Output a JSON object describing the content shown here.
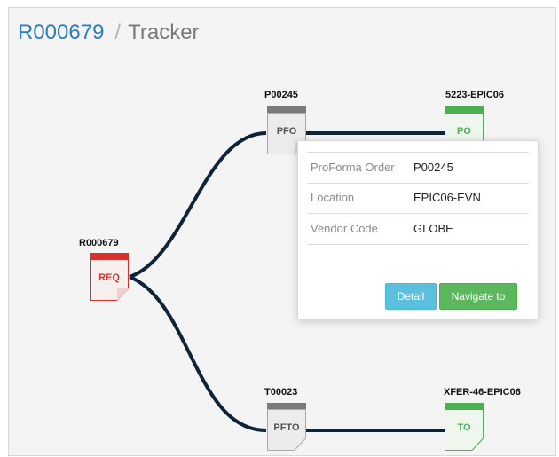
{
  "breadcrumb": {
    "link": "R000679",
    "separator": "/",
    "current": "Tracker"
  },
  "nodes": {
    "req": {
      "id": "R000679",
      "label": "REQ",
      "color": "#d9302b"
    },
    "pfo": {
      "id": "P00245",
      "label": "PFO",
      "color": "#7a7a7a"
    },
    "po": {
      "id": "5223-EPIC06",
      "label": "PO",
      "color": "#4caf50"
    },
    "pfto": {
      "id": "T00023",
      "label": "PFTO",
      "color": "#7a7a7a"
    },
    "to": {
      "id": "XFER-46-EPIC06",
      "label": "TO",
      "color": "#4caf50"
    }
  },
  "popover": {
    "rows": [
      {
        "key": "ProForma Order",
        "value": "P00245"
      },
      {
        "key": "Location",
        "value": "EPIC06-EVN"
      },
      {
        "key": "Vendor Code",
        "value": "GLOBE"
      }
    ],
    "detail_label": "Detail",
    "navigate_label": "Navigate to"
  },
  "colors": {
    "link_line": "#0e2438",
    "breadcrumb_link": "#2f7bbf"
  }
}
